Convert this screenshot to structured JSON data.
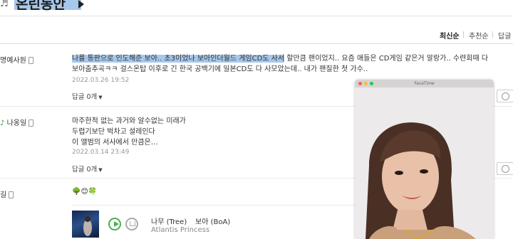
{
  "header": {
    "title": "온린동안"
  },
  "sort": {
    "options": [
      "최신순",
      "추천순",
      "답글"
    ]
  },
  "comments": [
    {
      "user": "명예사원",
      "text_selected": "나를 통판으로 인도해준 보아.. 초3이었나 보아인더월드 게임CD도 사서",
      "text_rest_line1": "할만큼 팬이었지.. 요즘 애들은 CD게임 같은거 알랑가.. 수련회때 다",
      "text_line2": "보아춤추곡ㅋㅋ 걸스온탑 이후로 긴 한국 공백기에 일본CD도 다 사모았는데.. 내가 팬질한 첫 가수..",
      "date": "2022.03.26  19:52",
      "reply": "답글 0개"
    },
    {
      "user": "나옹일",
      "text_line1": "마주한적 없는 과거와 알수없는 미래가",
      "text_line2": "두렵기보단 벅차고 설레인다",
      "text_line3": "이 앨범의 서사에서 만큼은…",
      "date": "2022.03.14  23:49",
      "reply": "답글 0개"
    },
    {
      "user": "길",
      "emoji": "🌳😊🍀",
      "song": {
        "title": "나무 (Tree)",
        "artist": "보아 (BoA)",
        "album": "Atlantis Princess"
      }
    }
  ],
  "facetime": {
    "window_title": "FaceTime"
  },
  "colors": {
    "selection": "#a6c8ec",
    "accent_green": "#4caf50"
  }
}
